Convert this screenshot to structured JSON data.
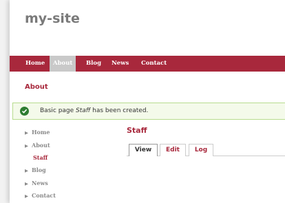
{
  "header": {
    "site_name": "my-site"
  },
  "navbar": {
    "items": [
      {
        "label": "Home",
        "active": false
      },
      {
        "label": "About",
        "active": true
      },
      {
        "label": "Blog",
        "active": false
      },
      {
        "label": "News",
        "active": false
      },
      {
        "label": "Contact",
        "active": false
      }
    ]
  },
  "breadcrumb": {
    "label": "About"
  },
  "status": {
    "icon": "check-circle-icon",
    "prefix": "Basic page ",
    "title": "Staff",
    "suffix": " has been created."
  },
  "sidebar": {
    "items": [
      {
        "label": "Home",
        "current": false,
        "icon": "triangle-right-icon"
      },
      {
        "label": "About",
        "current": false,
        "icon": "triangle-right-icon"
      },
      {
        "label": "Staff",
        "current": true
      },
      {
        "label": "Blog",
        "current": false,
        "icon": "triangle-right-icon"
      },
      {
        "label": "News",
        "current": false,
        "icon": "triangle-right-icon"
      },
      {
        "label": "Contact",
        "current": false,
        "icon": "triangle-right-icon"
      }
    ]
  },
  "content": {
    "title": "Staff",
    "tabs": [
      {
        "label": "View",
        "active": true
      },
      {
        "label": "Edit",
        "active": false
      },
      {
        "label": "Log",
        "active": false
      }
    ]
  },
  "colors": {
    "accent": "#a8283c",
    "success_border": "#b7dc8e",
    "success_bg": "#f4faea",
    "success_icon": "#2e7d32"
  }
}
